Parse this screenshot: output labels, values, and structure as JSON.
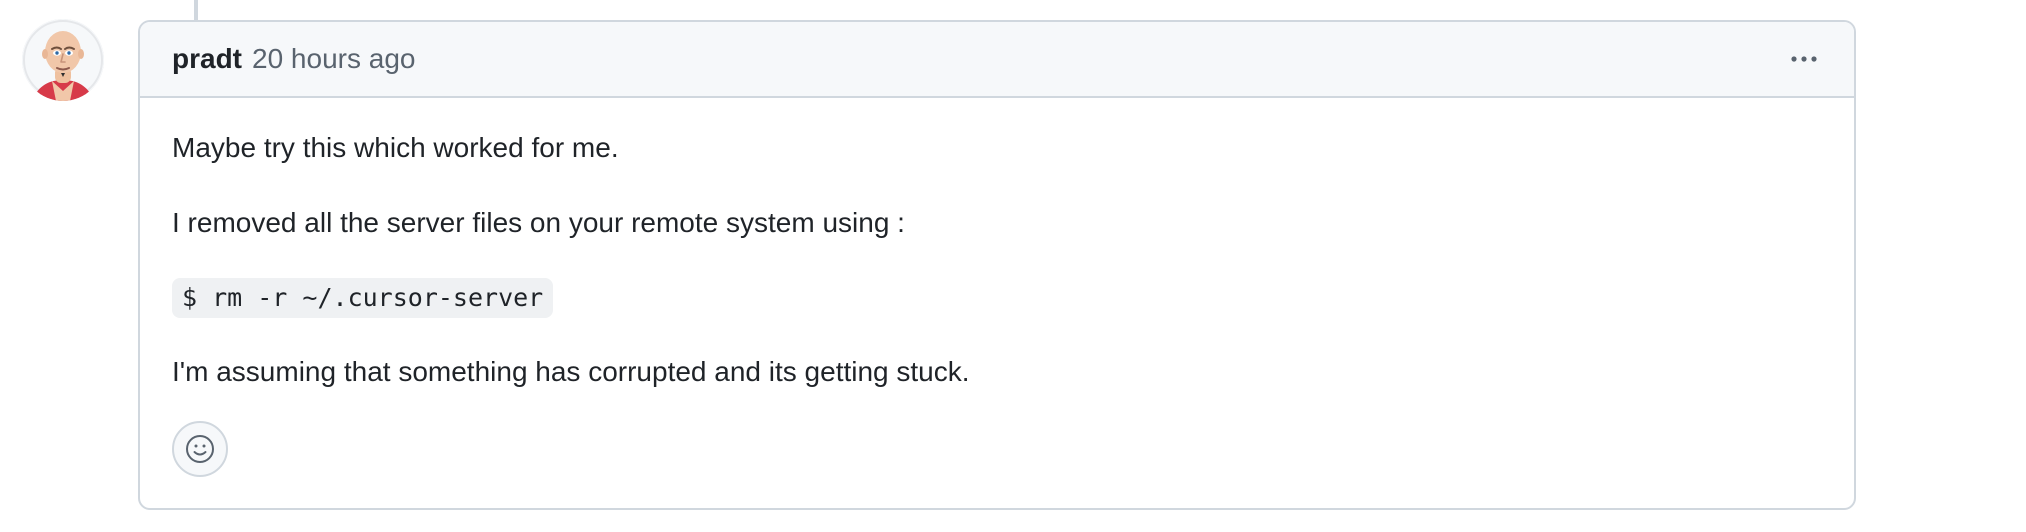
{
  "comment": {
    "author": "pradt",
    "timestamp": "20 hours ago",
    "body": {
      "paragraph_1": "Maybe try this which worked for me.",
      "paragraph_2": "I removed all the server files on your remote system using :",
      "code": "$ rm -r ~/.cursor-server",
      "paragraph_3": "I'm assuming that something has corrupted and its getting stuck."
    }
  },
  "icons": {
    "avatar": "avatar",
    "menu": "kebab-horizontal-icon",
    "reaction": "smiley-icon"
  },
  "colors": {
    "border": "#d0d7de",
    "header_bg": "#f6f8fa",
    "text": "#1f2328",
    "muted": "#59636e",
    "code_bg": "#eff1f3"
  }
}
